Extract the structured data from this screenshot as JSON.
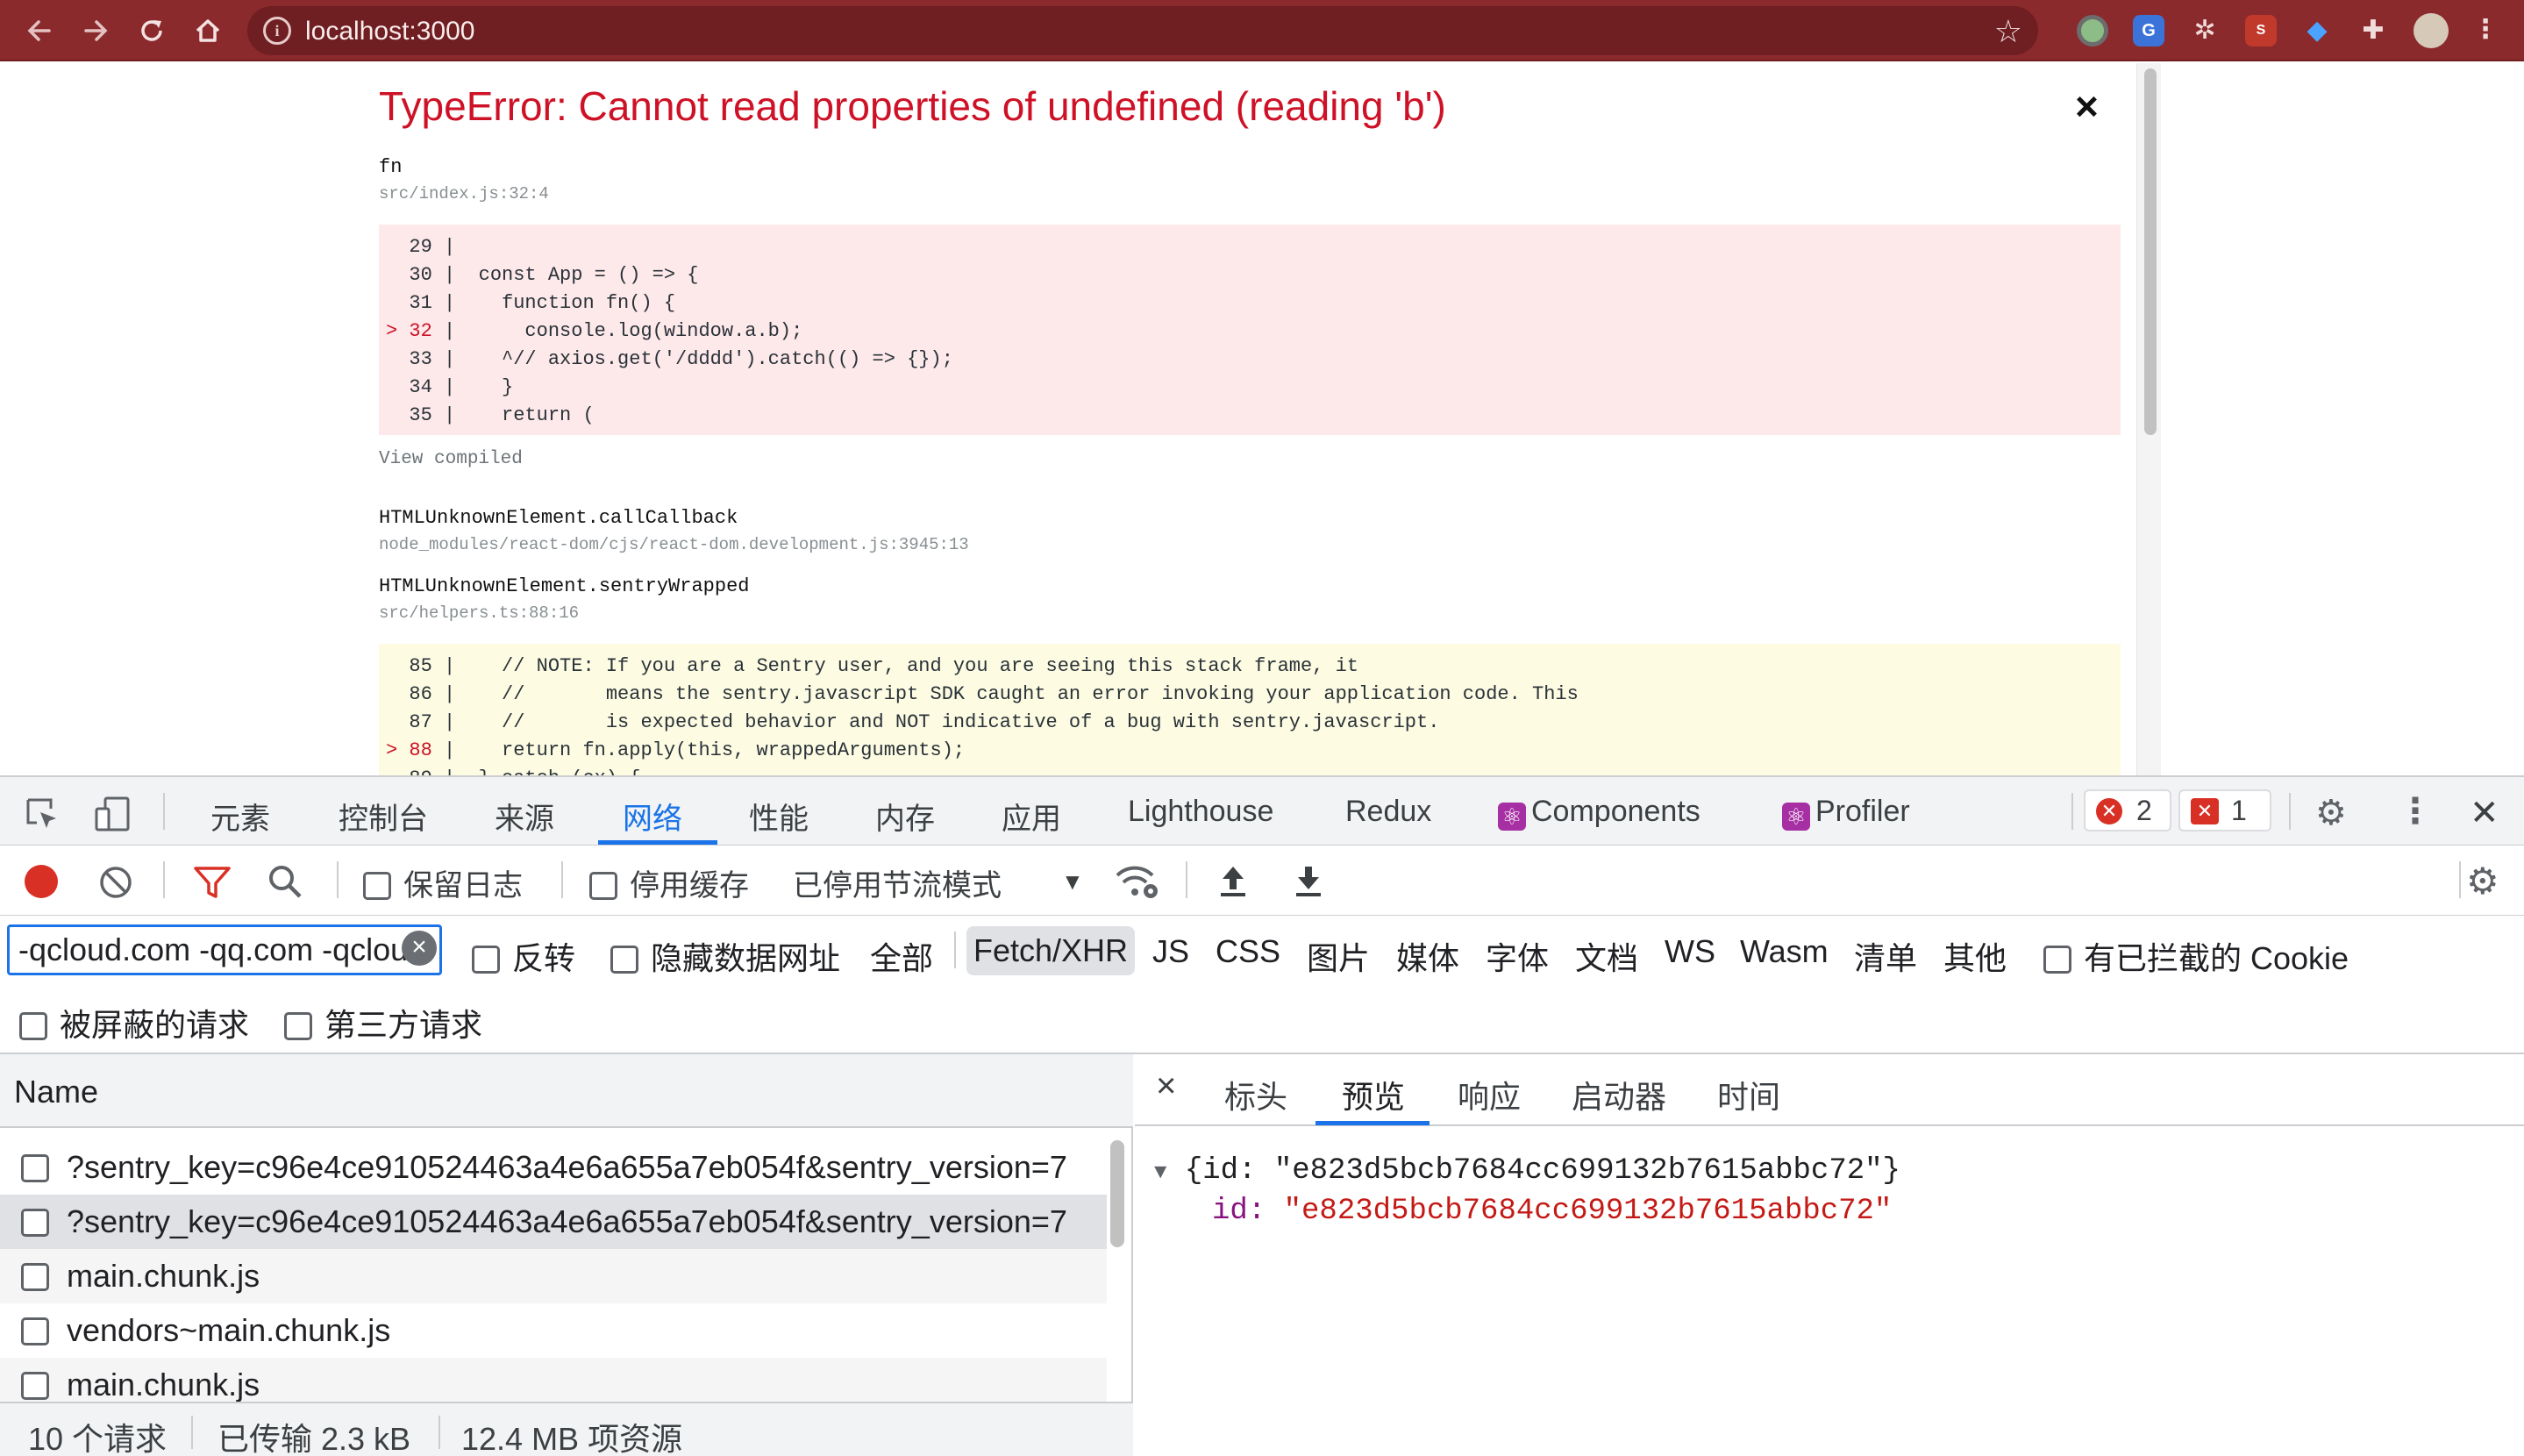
{
  "browser": {
    "url": "localhost:3000",
    "nav_icons": [
      "back-icon",
      "forward-icon",
      "reload-icon",
      "home-icon"
    ],
    "extensions": [
      "green-circle-extension",
      "translate-extension",
      "fan-extension",
      "red-square-extension",
      "gem-extension",
      "puzzle-extension",
      "profile-avatar",
      "menu-icon"
    ]
  },
  "overlay": {
    "title": "TypeError: Cannot read properties of undefined (reading 'b')",
    "close": "×",
    "frame1": {
      "fn": "fn",
      "loc": "src/index.js:32:4"
    },
    "code1": [
      {
        "num": "29",
        "marker": " ",
        "text": ""
      },
      {
        "num": "30",
        "marker": " ",
        "text": "const App = () => {"
      },
      {
        "num": "31",
        "marker": " ",
        "text": "  function fn() {"
      },
      {
        "num": "32",
        "marker": ">",
        "text": "    console.log(window.a.b);"
      },
      {
        "num": "33",
        "marker": " ",
        "text": "  ^// axios.get('/dddd').catch(() => {});"
      },
      {
        "num": "34",
        "marker": " ",
        "text": "  }"
      },
      {
        "num": "35",
        "marker": " ",
        "text": "  return ("
      }
    ],
    "view_compiled": "View compiled",
    "frame2": {
      "fn": "HTMLUnknownElement.callCallback",
      "loc": "node_modules/react-dom/cjs/react-dom.development.js:3945:13"
    },
    "frame3": {
      "fn": "HTMLUnknownElement.sentryWrapped",
      "loc": "src/helpers.ts:88:16"
    },
    "code2": [
      {
        "num": "85",
        "marker": " ",
        "text": "  // NOTE: If you are a Sentry user, and you are seeing this stack frame, it"
      },
      {
        "num": "86",
        "marker": " ",
        "text": "  //       means the sentry.javascript SDK caught an error invoking your application code. This"
      },
      {
        "num": "87",
        "marker": " ",
        "text": "  //       is expected behavior and NOT indicative of a bug with sentry.javascript."
      },
      {
        "num": "88",
        "marker": ">",
        "text": "  return fn.apply(this, wrappedArguments);"
      },
      {
        "num": "89",
        "marker": " ",
        "text": "} catch (ex) {"
      }
    ]
  },
  "devtools": {
    "tabs": [
      "元素",
      "控制台",
      "来源",
      "网络",
      "性能",
      "内存",
      "应用",
      "Lighthouse",
      "Redux",
      "Components",
      "Profiler"
    ],
    "active_tab": "网络",
    "error_count": "2",
    "issue_count": "1",
    "network_toolbar": {
      "preserve_log": "保留日志",
      "disable_cache": "停用缓存",
      "throttle": "已停用节流模式"
    },
    "filter": {
      "value": "-qcloud.com -qq.com -qcloud",
      "invert": "反转",
      "hide_data_urls": "隐藏数据网址",
      "types": [
        "全部",
        "Fetch/XHR",
        "JS",
        "CSS",
        "图片",
        "媒体",
        "字体",
        "文档",
        "WS",
        "Wasm",
        "清单",
        "其他"
      ],
      "selected_type": "Fetch/XHR",
      "blocked_cookies": "有已拦截的 Cookie",
      "blocked_requests": "被屏蔽的请求",
      "third_party": "第三方请求"
    },
    "requests": {
      "header": "Name",
      "rows": [
        "?sentry_key=c96e4ce910524463a4e6a655a7eb054f&sentry_version=7",
        "?sentry_key=c96e4ce910524463a4e6a655a7eb054f&sentry_version=7",
        "main.chunk.js",
        "vendors~main.chunk.js",
        "main.chunk.js"
      ]
    },
    "status": {
      "requests": "10 个请求",
      "transferred": "已传输 2.3 kB",
      "resources": "12.4 MB 项资源"
    },
    "detail": {
      "close": "×",
      "tabs": [
        "标头",
        "预览",
        "响应",
        "启动器",
        "时间"
      ],
      "active_tab": "预览",
      "preview_root": "{id: \"e823d5bcb7684cc699132b7615abbc72\"}",
      "preview_key": "id",
      "preview_value": "\"e823d5bcb7684cc699132b7615abbc72\""
    }
  }
}
